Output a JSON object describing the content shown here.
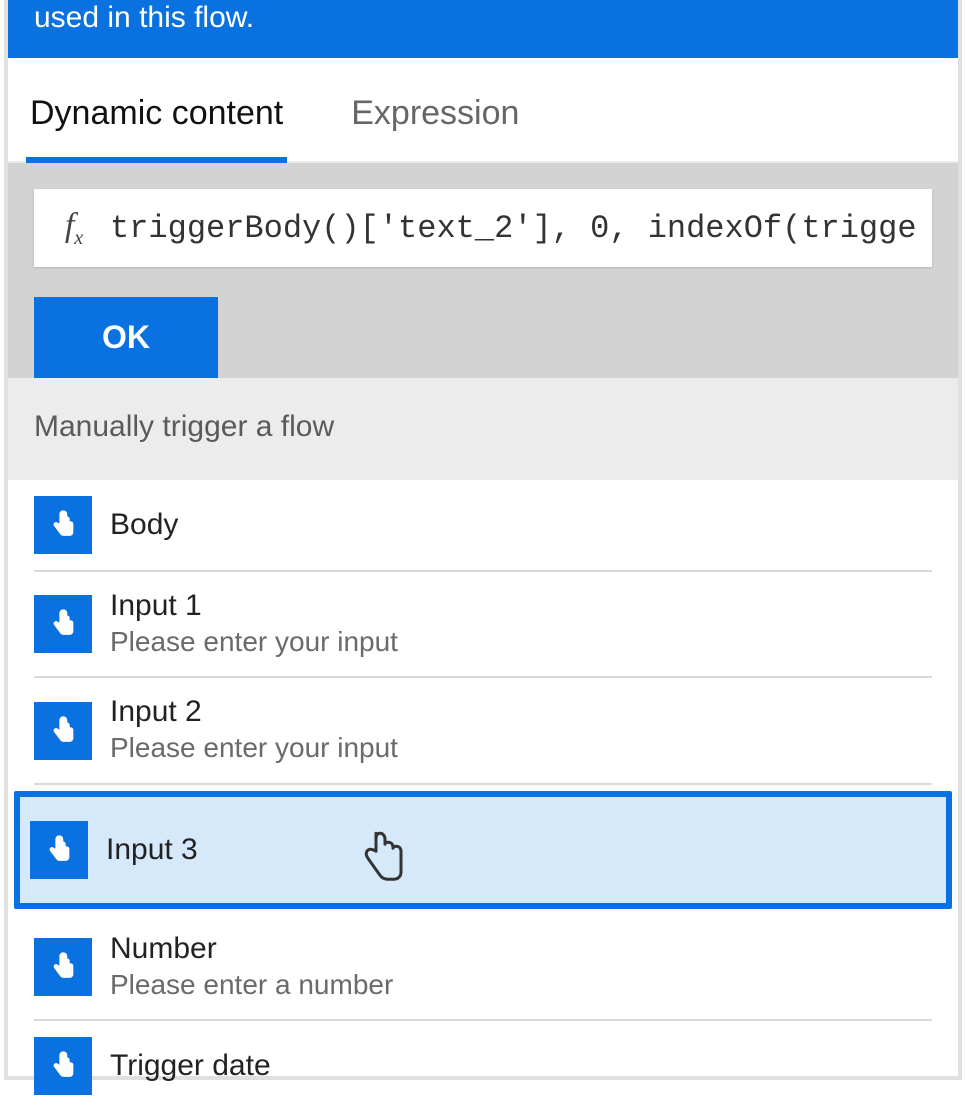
{
  "banner": {
    "text": "used in this flow."
  },
  "tabs": {
    "dynamic": "Dynamic content",
    "expression": "Expression"
  },
  "formula": {
    "fx": "fx",
    "value": "triggerBody()['text_2'], 0, indexOf(trigge",
    "ok": "OK"
  },
  "section": {
    "header": "Manually trigger a flow"
  },
  "items": [
    {
      "title": "Body",
      "sub": ""
    },
    {
      "title": "Input 1",
      "sub": "Please enter your input"
    },
    {
      "title": "Input 2",
      "sub": "Please enter your input"
    },
    {
      "title": "Input 3",
      "sub": ""
    },
    {
      "title": "Number",
      "sub": "Please enter a number"
    },
    {
      "title": "Trigger date",
      "sub": ""
    }
  ]
}
